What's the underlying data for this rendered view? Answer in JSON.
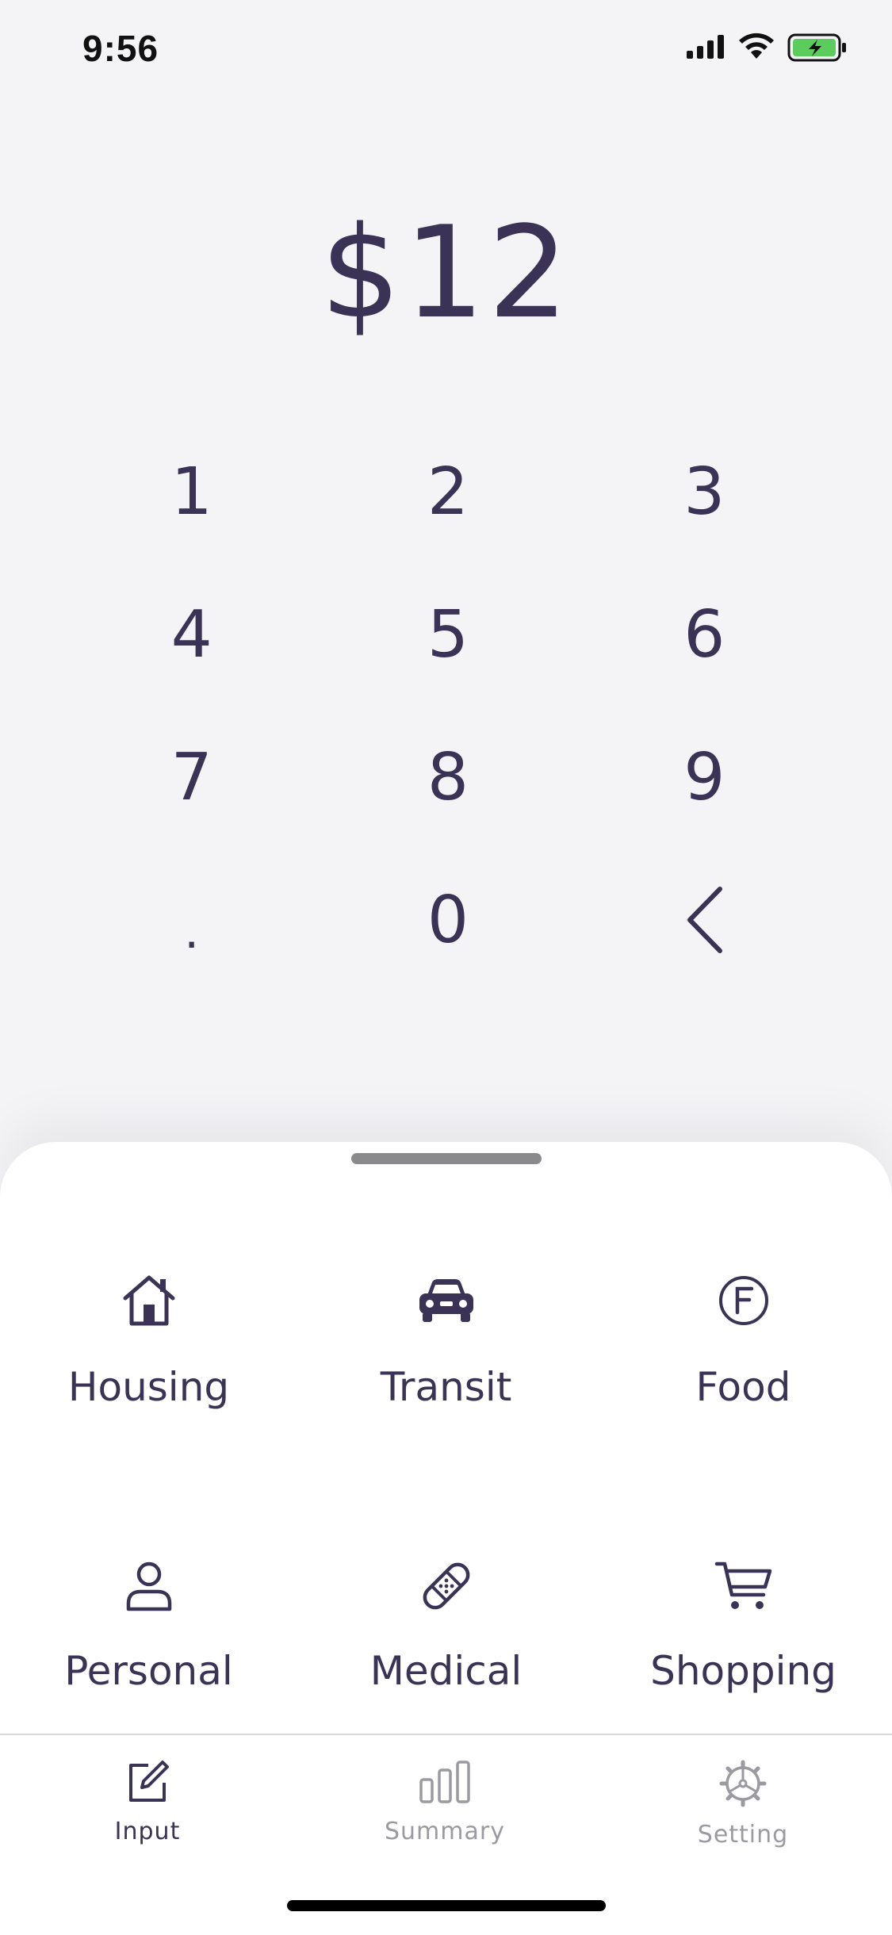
{
  "status_bar": {
    "time": "9:56"
  },
  "amount": "$12",
  "keypad": {
    "keys": [
      "1",
      "2",
      "3",
      "4",
      "5",
      "6",
      "7",
      "8",
      "9",
      ".",
      "0"
    ],
    "backspace_icon": "chevron-left-icon"
  },
  "categories": [
    {
      "label": "Housing",
      "icon": "house-icon"
    },
    {
      "label": "Transit",
      "icon": "car-icon"
    },
    {
      "label": "Food",
      "icon": "food-f-icon"
    },
    {
      "label": "Personal",
      "icon": "person-icon"
    },
    {
      "label": "Medical",
      "icon": "bandage-icon"
    },
    {
      "label": "Shopping",
      "icon": "cart-icon"
    }
  ],
  "tab_bar": {
    "tabs": [
      {
        "label": "Input",
        "icon": "edit-icon",
        "active": true
      },
      {
        "label": "Summary",
        "icon": "bar-chart-icon",
        "active": false
      },
      {
        "label": "Setting",
        "icon": "gear-icon",
        "active": false
      }
    ]
  },
  "colors": {
    "accent": "#3b3355",
    "inactive": "#9a9aa0",
    "background": "#f4f4f7",
    "battery": "#5ccd5c"
  }
}
